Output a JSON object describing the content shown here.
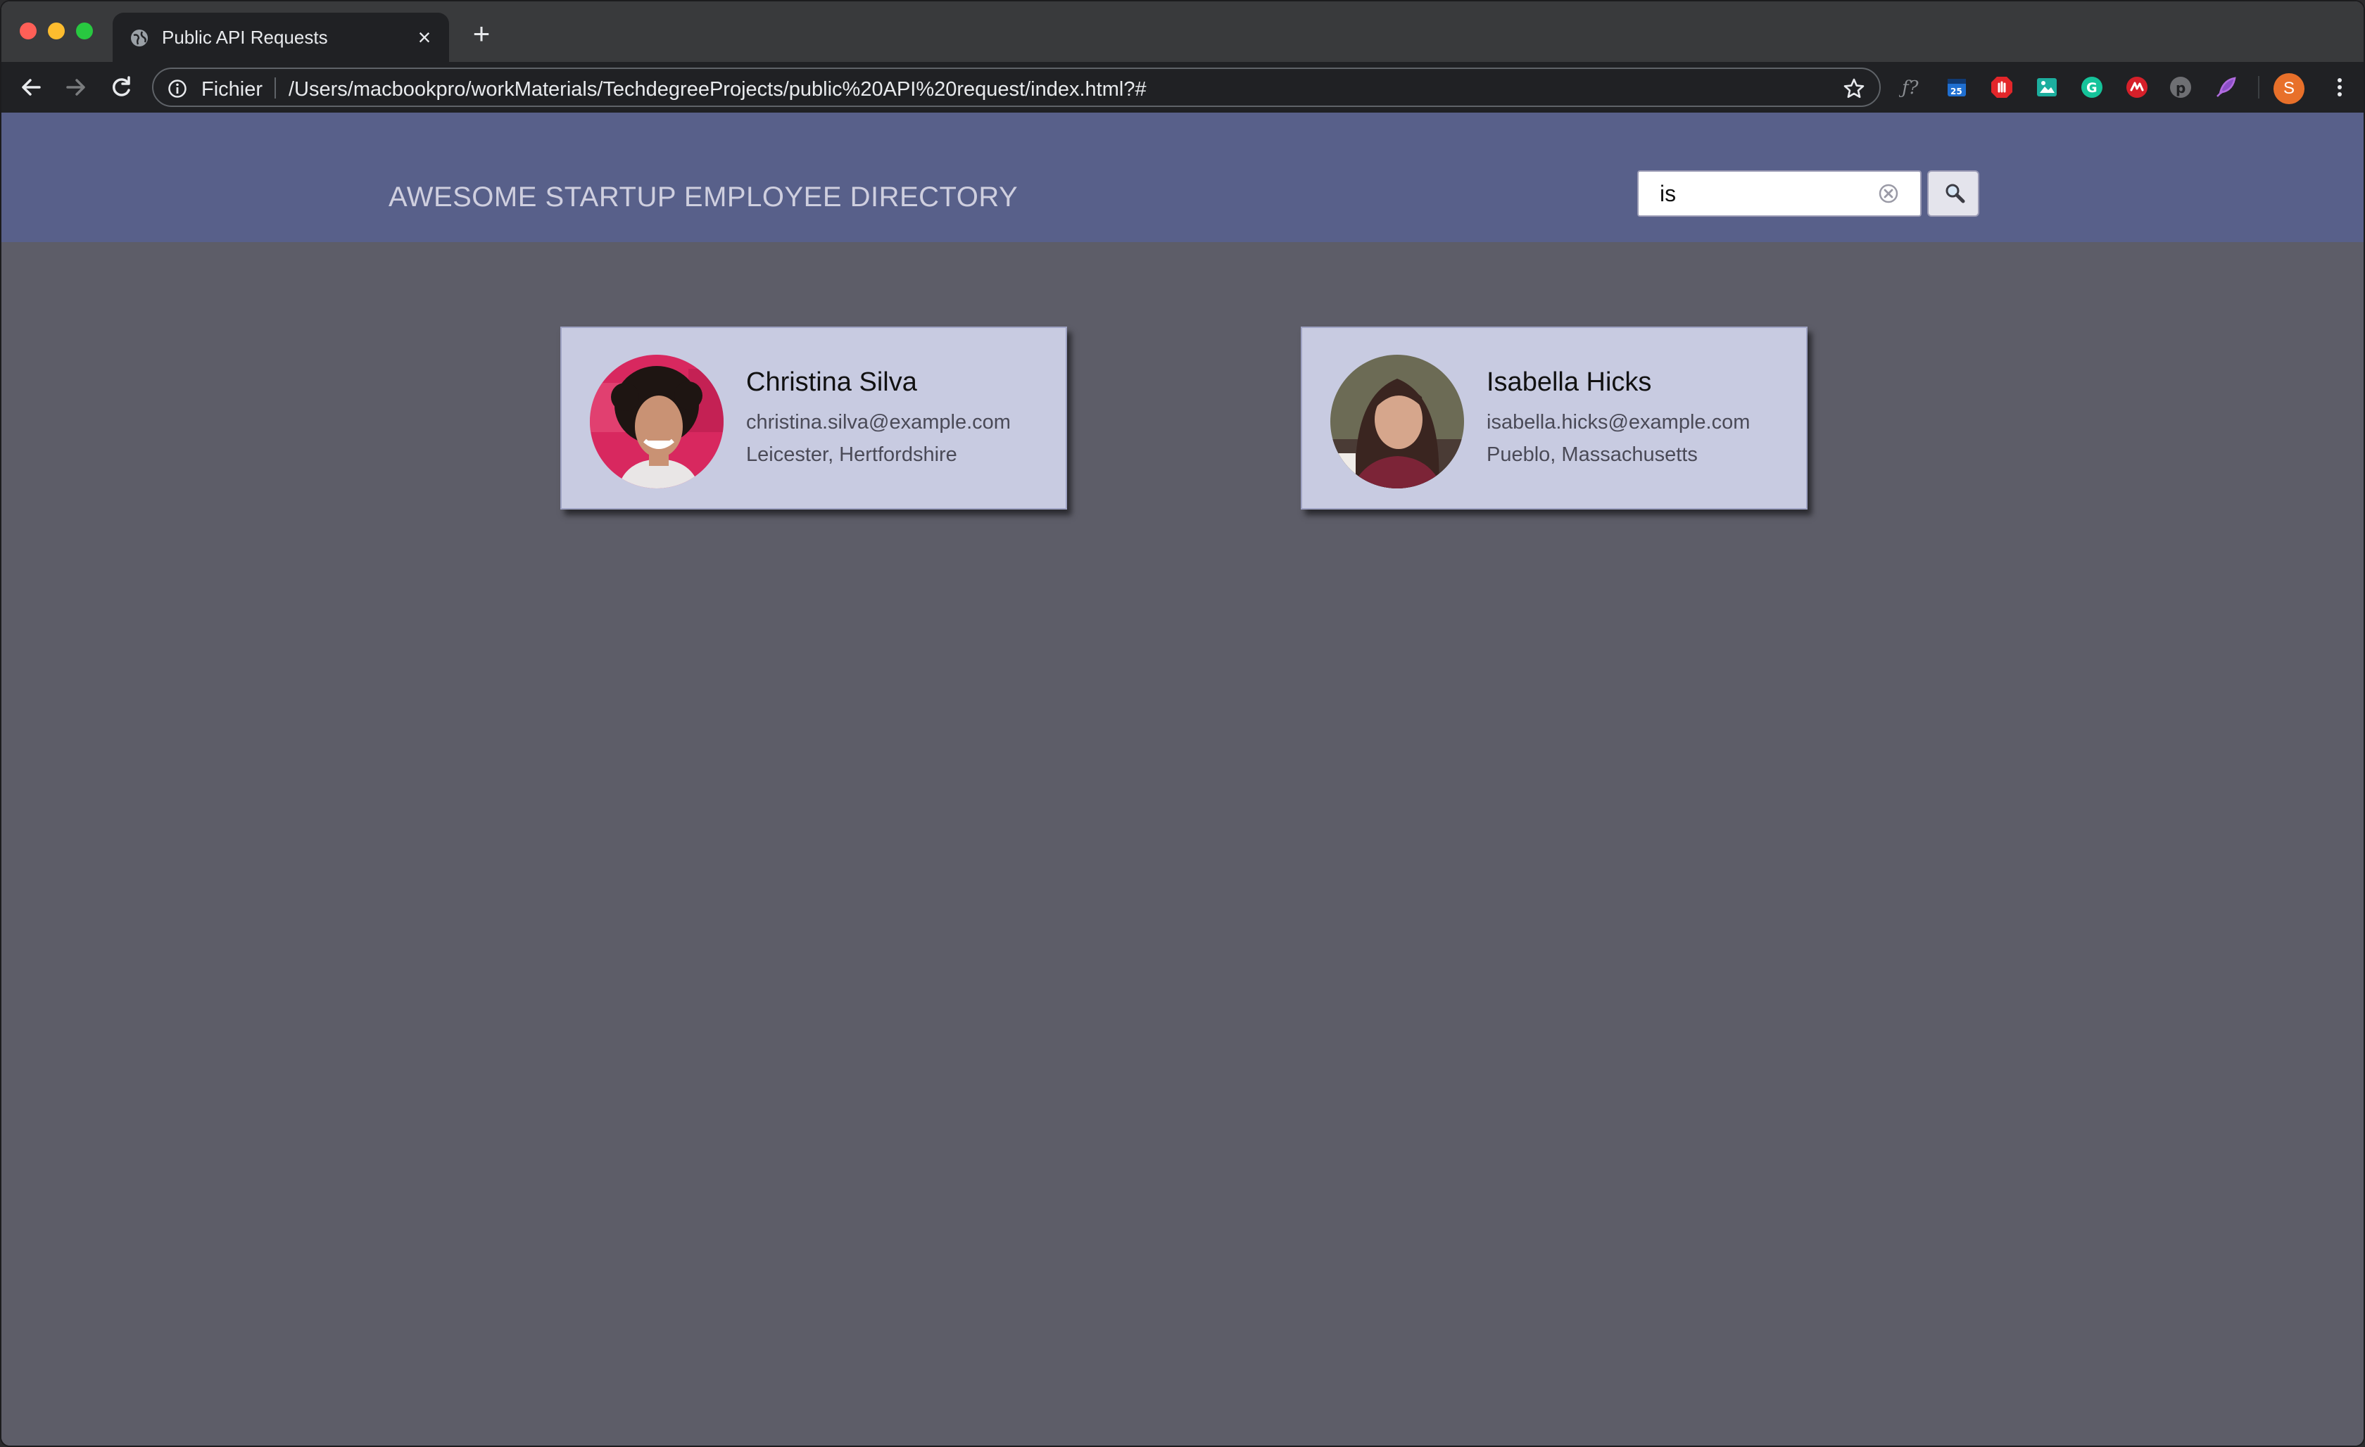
{
  "browser": {
    "tab_title": "Public API Requests",
    "scheme_label": "Fichier",
    "url": "/Users/macbookpro/workMaterials/TechdegreeProjects/public%20API%20request/index.html?#",
    "profile_initial": "S"
  },
  "header": {
    "title": "AWESOME STARTUP EMPLOYEE DIRECTORY"
  },
  "search": {
    "value": "is",
    "placeholder": ""
  },
  "employees": [
    {
      "name": "Christina Silva",
      "email": "christina.silva@example.com",
      "location": "Leicester, Hertfordshire"
    },
    {
      "name": "Isabella Hicks",
      "email": "isabella.hicks@example.com",
      "location": "Pueblo, Massachusetts"
    }
  ],
  "colors": {
    "header_bg": "#58608a",
    "page_bg": "#5d5d68",
    "card_bg": "#c8cbe1"
  }
}
